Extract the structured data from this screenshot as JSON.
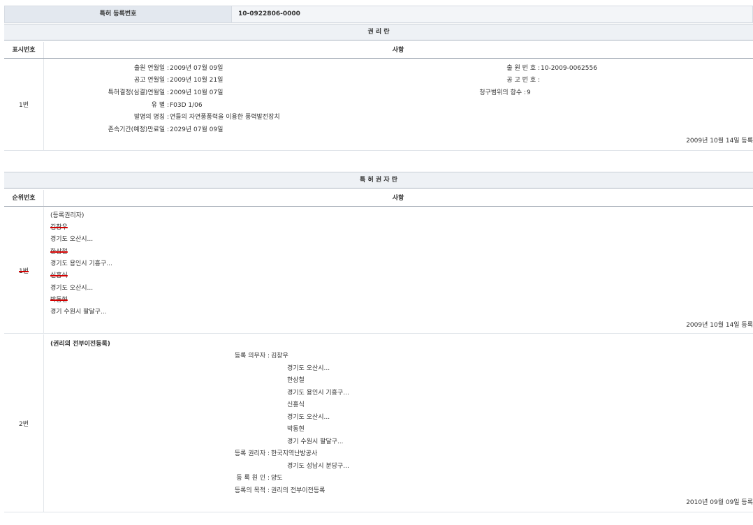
{
  "header": {
    "label": "특허 등록번호",
    "value": "10-0922806-0000"
  },
  "rights": {
    "title": "권 리 란",
    "col_index": "표시번호",
    "col_content": "사항",
    "row": {
      "index": "1번",
      "fields_left": [
        {
          "label": "출원 연월일 :",
          "value": "2009년 07월 09일"
        },
        {
          "label": "공고 연월일 :",
          "value": "2009년 10월 21일"
        },
        {
          "label": "특허결정(심결)연월일 :",
          "value": "2009년 10월 07일"
        },
        {
          "label": "유 별 :",
          "value": "F03D 1/06"
        },
        {
          "label": "발명의 명칭 :",
          "value": "연들의 자연풍풍력을 이용한 풍력발전장치"
        },
        {
          "label": "존속기간(예정)만료일 :",
          "value": "2029년 07월 09일"
        }
      ],
      "fields_right": [
        {
          "label": "출 원 번 호 :",
          "value": "10-2009-0062556"
        },
        {
          "label": "공 고 번 호 :",
          "value": ""
        },
        {
          "label": "청구범위의 항수 :",
          "value": "9"
        }
      ],
      "date": "2009년 10월 14일 등록"
    }
  },
  "holders": {
    "title": "특 허 권 자 란",
    "col_index": "순위번호",
    "col_content": "사항",
    "row1": {
      "index": "1번",
      "heading": "(등록권리자)",
      "lines": [
        {
          "text": "김창우",
          "struck": true
        },
        {
          "text": "경기도 오산시...",
          "struck": false
        },
        {
          "text": "한상철",
          "struck": true
        },
        {
          "text": "경기도 용인시 기흥구...",
          "struck": false
        },
        {
          "text": "신홍식",
          "struck": true
        },
        {
          "text": "경기도 오산시...",
          "struck": false
        },
        {
          "text": "박동현",
          "struck": true
        },
        {
          "text": "경기 수원시 팔달구...",
          "struck": false
        }
      ],
      "date": "2009년 10월 14일 등록"
    },
    "row2": {
      "index": "2번",
      "heading": "(권리의 전부이전등록)",
      "obligor_label": "등록 의무자 :",
      "obligor_lines": [
        "김창우",
        "경기도 오산시...",
        "한상철",
        "경기도 용인시 기흥구...",
        "신홍식",
        "경기도 오산시...",
        "박동현",
        "경기 수원시 팔달구..."
      ],
      "holder_label": "등록 권리자 :",
      "holder_lines": [
        "한국지역난방공사",
        "경기도 성남시 분당구..."
      ],
      "cause_label": "등 록 원 인 :",
      "cause_value": "양도",
      "purpose_label": "등록의 목적 :",
      "purpose_value": "권리의 전부이전등록",
      "date": "2010년 09월 09일 등록"
    }
  }
}
